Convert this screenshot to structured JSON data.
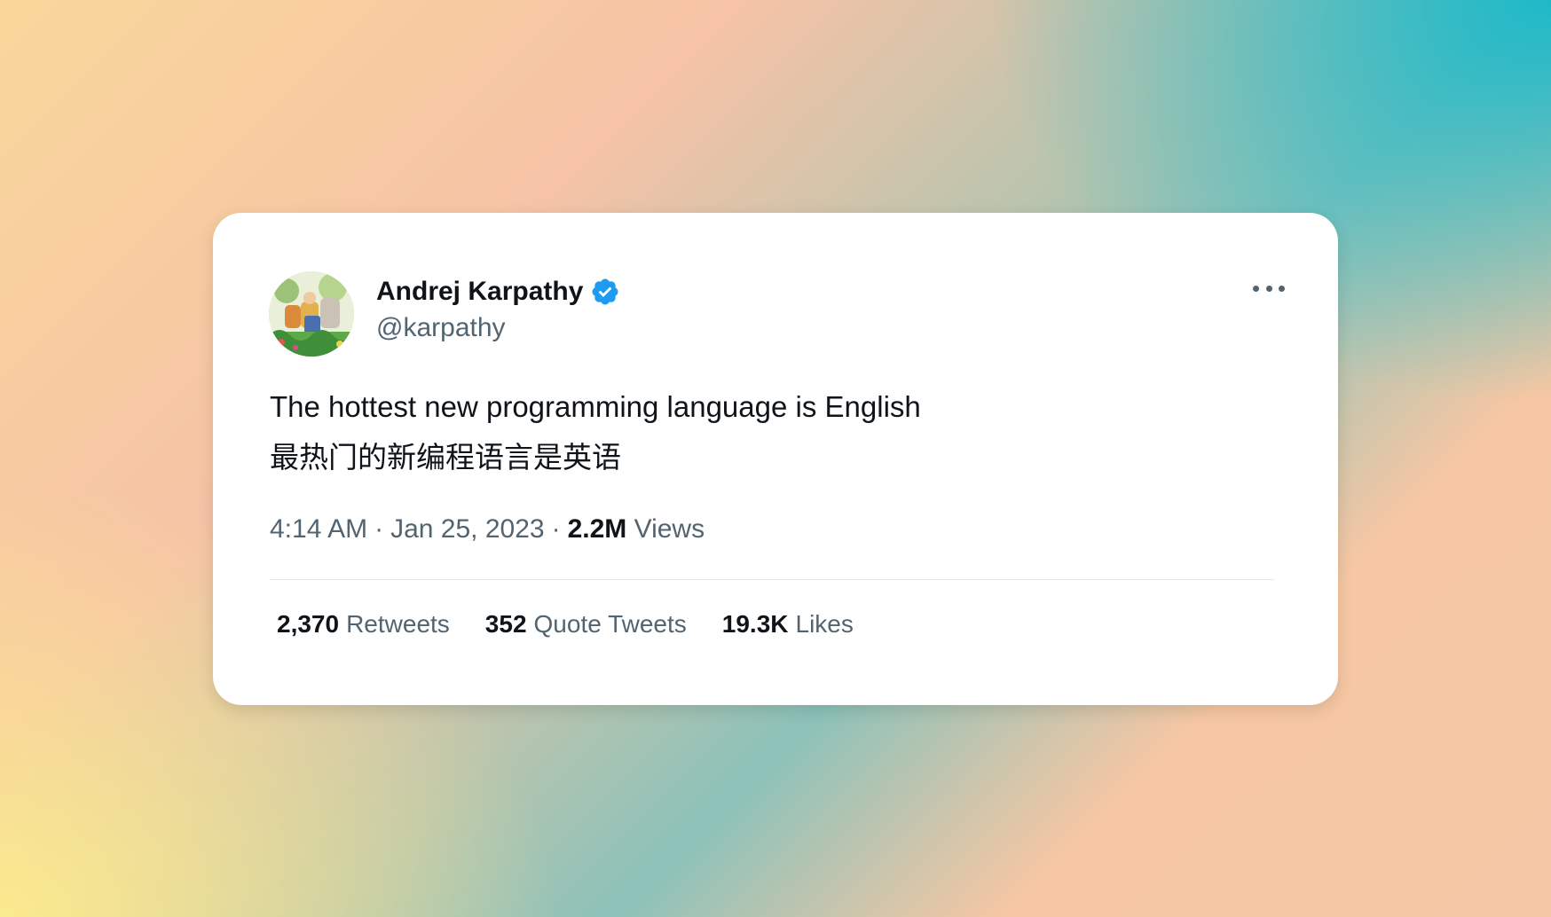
{
  "tweet": {
    "author": {
      "name": "Andrej Karpathy",
      "handle": "@karpathy",
      "verified": true,
      "verified_color": "#1d9bf0"
    },
    "text_lines": [
      "The hottest new programming language is English",
      "最热门的新编程语言是英语"
    ],
    "time": "4:14 AM",
    "date": "Jan 25, 2023",
    "separator": "·",
    "views_count": "2.2M",
    "views_label": "Views",
    "stats": {
      "retweets": {
        "count": "2,370",
        "label": "Retweets"
      },
      "quote_tweets": {
        "count": "352",
        "label": "Quote Tweets"
      },
      "likes": {
        "count": "19.3K",
        "label": "Likes"
      }
    }
  },
  "icons": {
    "more": "more-horizontal-icon",
    "verified": "verified-badge-icon"
  }
}
